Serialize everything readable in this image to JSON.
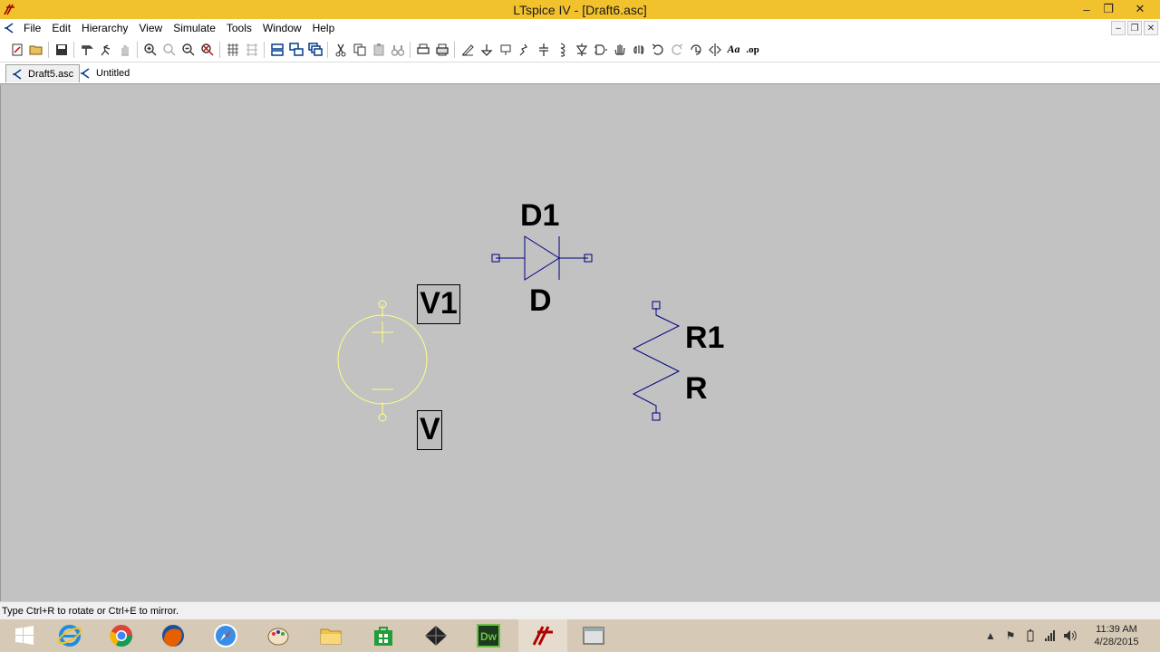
{
  "window": {
    "title": "LTspice IV - [Draft6.asc]"
  },
  "menu": {
    "items": [
      "File",
      "Edit",
      "Hierarchy",
      "View",
      "Simulate",
      "Tools",
      "Window",
      "Help"
    ]
  },
  "tabs": [
    {
      "label": "Draft5.asc"
    },
    {
      "label": "Untitled"
    }
  ],
  "schematic": {
    "diode": {
      "ref": "D1",
      "value": "D"
    },
    "voltage_source": {
      "ref": "V1",
      "value": "V"
    },
    "resistor": {
      "ref": "R1",
      "value": "R"
    }
  },
  "status": {
    "text": "Type Ctrl+R to rotate or Ctrl+E to mirror."
  },
  "clock": {
    "time": "11:39 AM",
    "date": "4/28/2015"
  },
  "colors": {
    "titlebar": "#f2c12e",
    "wire": "#000080",
    "selected": "#ffff80",
    "canvas": "#c2c2c2"
  }
}
